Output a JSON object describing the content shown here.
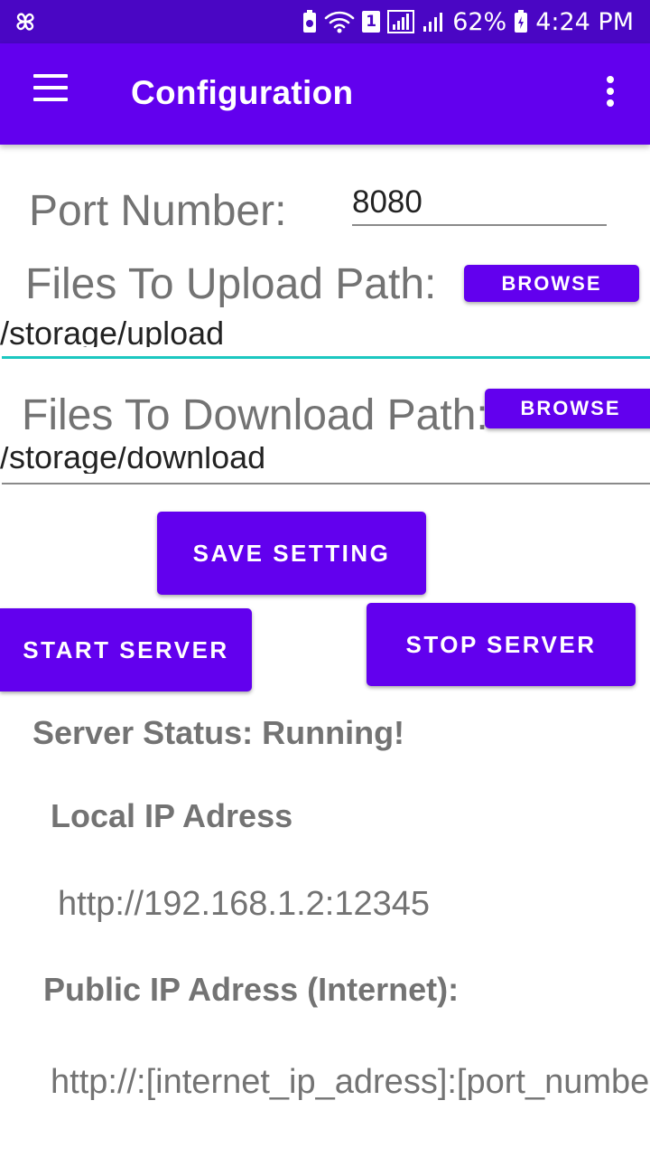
{
  "status_bar": {
    "battery_percent": "62%",
    "time": "4:24 PM",
    "sim_badge": "1",
    "icons": [
      "pinwheel-icon",
      "battery-saver-icon",
      "wifi-icon",
      "sim-icon",
      "signal-icon",
      "signal-icon",
      "battery-icon"
    ]
  },
  "app_bar": {
    "title": "Configuration",
    "menu_icon": "hamburger-menu-icon",
    "overflow_icon": "more-vert-icon"
  },
  "port": {
    "label": "Port Number:",
    "value": "8080"
  },
  "upload": {
    "label": "Files To Upload Path:",
    "browse_label": "BROWSE",
    "value": "/storage/upload"
  },
  "download": {
    "label": "Files To Download Path:",
    "browse_label": "BROWSE",
    "value": "/storage/download"
  },
  "buttons": {
    "save": "SAVE SETTING",
    "start": "START SERVER",
    "stop": "STOP SERVER"
  },
  "server_status": "Server Status: Running!",
  "local_ip": {
    "label": "Local IP Adress",
    "value": "http://192.168.1.2:12345"
  },
  "public_ip": {
    "label": "Public IP Adress (Internet):",
    "value": "http://:[internet_ip_adress]:[port_number]"
  },
  "colors": {
    "status_bar": "#4a06c4",
    "primary": "#6200ee",
    "accent_underline": "#1bc7c0",
    "muted_text": "#737373"
  }
}
